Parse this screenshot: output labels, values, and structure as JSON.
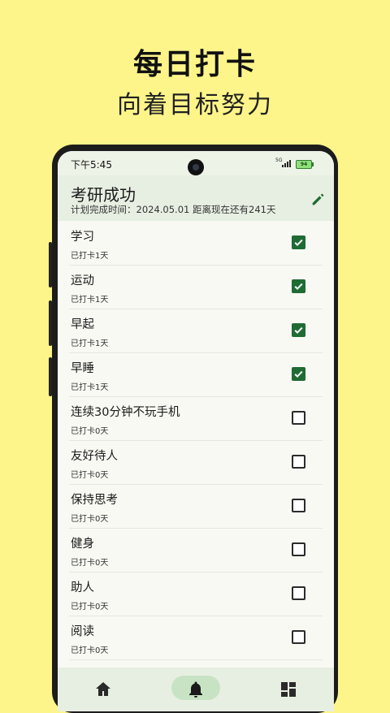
{
  "promo": {
    "title": "每日打卡",
    "subtitle": "向着目标努力"
  },
  "status_bar": {
    "time": "下午5:45",
    "network": "5G",
    "battery": "94"
  },
  "goal": {
    "title": "考研成功",
    "subtitle": "计划完成时间：2024.05.01 距离现在还有241天"
  },
  "habits": [
    {
      "name": "学习",
      "count": "已打卡1天",
      "checked": true
    },
    {
      "name": "运动",
      "count": "已打卡1天",
      "checked": true
    },
    {
      "name": "早起",
      "count": "已打卡1天",
      "checked": true
    },
    {
      "name": "早睡",
      "count": "已打卡1天",
      "checked": true
    },
    {
      "name": "连续30分钟不玩手机",
      "count": "已打卡0天",
      "checked": false
    },
    {
      "name": "友好待人",
      "count": "已打卡0天",
      "checked": false
    },
    {
      "name": "保持思考",
      "count": "已打卡0天",
      "checked": false
    },
    {
      "name": "健身",
      "count": "已打卡0天",
      "checked": false
    },
    {
      "name": "助人",
      "count": "已打卡0天",
      "checked": false
    },
    {
      "name": "阅读",
      "count": "已打卡0天",
      "checked": false
    }
  ],
  "nav": {
    "items": [
      "home-icon",
      "bell-icon",
      "grid-icon"
    ],
    "active": "bell-icon"
  },
  "colors": {
    "background": "#fdf589",
    "accent": "#1f6b34",
    "header": "#e7efe2"
  }
}
